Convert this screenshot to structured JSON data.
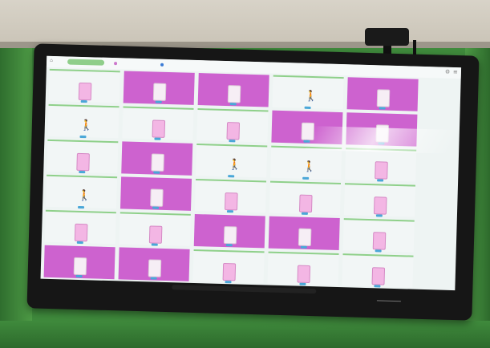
{
  "topbar": {
    "items": [
      "",
      "",
      ""
    ],
    "colors": [
      "#8fce8a",
      "#cc77cc",
      "#3a7bd5"
    ]
  },
  "brand": "",
  "cells": [
    {
      "variant": "light",
      "icon": "bed",
      "tone": "pink"
    },
    {
      "variant": "magenta",
      "icon": "bed",
      "tone": "white"
    },
    {
      "variant": "magenta",
      "icon": "bed",
      "tone": "white"
    },
    {
      "variant": "light",
      "icon": "person",
      "tone": "blue"
    },
    {
      "variant": "magenta",
      "icon": "bed",
      "tone": "white"
    },
    {
      "variant": "light",
      "icon": "person",
      "tone": "blue"
    },
    {
      "variant": "light",
      "icon": "bed",
      "tone": "pink"
    },
    {
      "variant": "light",
      "icon": "bed",
      "tone": "pink"
    },
    {
      "variant": "magenta",
      "icon": "bed",
      "tone": "white"
    },
    {
      "variant": "magenta",
      "icon": "bed",
      "tone": "white"
    },
    {
      "variant": "light",
      "icon": "bed",
      "tone": "pink"
    },
    {
      "variant": "magenta",
      "icon": "bed",
      "tone": "white"
    },
    {
      "variant": "light",
      "icon": "person",
      "tone": "blue"
    },
    {
      "variant": "light",
      "icon": "person",
      "tone": "blue"
    },
    {
      "variant": "light",
      "icon": "bed",
      "tone": "pink"
    },
    {
      "variant": "light",
      "icon": "person",
      "tone": "blue"
    },
    {
      "variant": "magenta",
      "icon": "bed",
      "tone": "white"
    },
    {
      "variant": "light",
      "icon": "bed",
      "tone": "pink"
    },
    {
      "variant": "light",
      "icon": "bed",
      "tone": "pink"
    },
    {
      "variant": "light",
      "icon": "bed",
      "tone": "pink"
    },
    {
      "variant": "light",
      "icon": "bed",
      "tone": "pink"
    },
    {
      "variant": "light",
      "icon": "bed",
      "tone": "pink"
    },
    {
      "variant": "magenta",
      "icon": "bed",
      "tone": "white"
    },
    {
      "variant": "magenta",
      "icon": "bed",
      "tone": "white"
    },
    {
      "variant": "light",
      "icon": "bed",
      "tone": "pink"
    },
    {
      "variant": "magenta",
      "icon": "bed",
      "tone": "white"
    },
    {
      "variant": "magenta",
      "icon": "bed",
      "tone": "white"
    },
    {
      "variant": "light",
      "icon": "bed",
      "tone": "pink"
    },
    {
      "variant": "light",
      "icon": "bed",
      "tone": "pink"
    },
    {
      "variant": "light",
      "icon": "bed",
      "tone": "pink"
    }
  ]
}
